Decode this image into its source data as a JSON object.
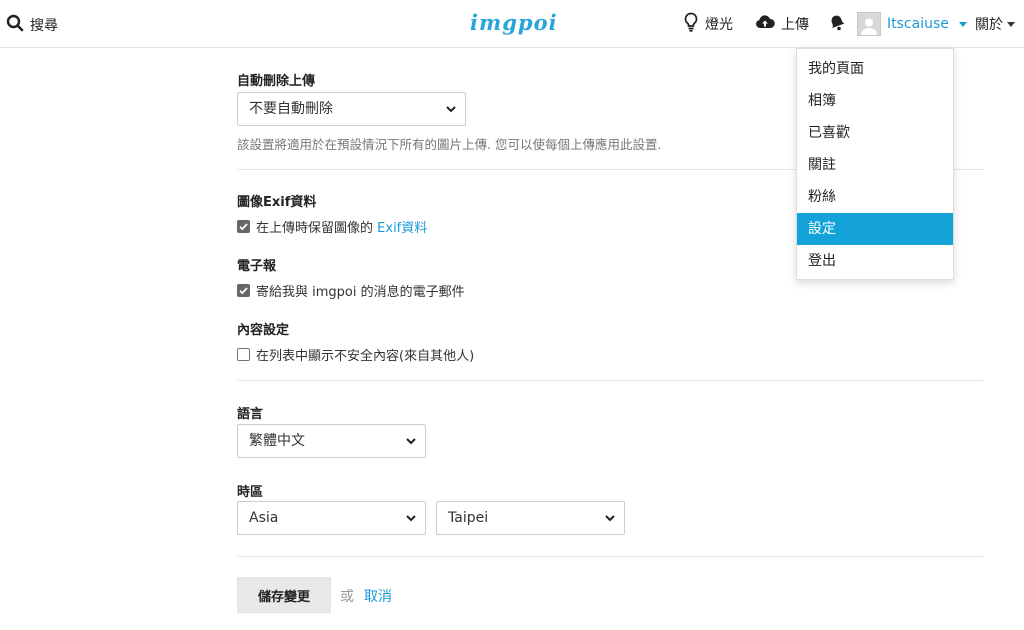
{
  "header": {
    "search_label": "搜尋",
    "logo": "imgpoi",
    "light_label": "燈光",
    "upload_label": "上傳",
    "username": "Itscaiuse",
    "about_label": "關於"
  },
  "user_menu": {
    "items": [
      "我的頁面",
      "相簿",
      "已喜歡",
      "關註",
      "粉絲",
      "設定",
      "登出"
    ],
    "active_index": 5
  },
  "settings": {
    "auto_delete": {
      "label": "自動刪除上傳",
      "value": "不要自動刪除",
      "help": "該設置將適用於在預設情況下所有的圖片上傳. 您可以使每個上傳應用此設置."
    },
    "exif": {
      "label": "圖像Exif資料",
      "checkbox_text": "在上傳時保留圖像的",
      "checkbox_link": "Exif資料",
      "checked": true
    },
    "newsletter": {
      "label": "電子報",
      "checkbox_text": "寄給我與 imgpoi 的消息的電子郵件",
      "checked": true
    },
    "content": {
      "label": "內容設定",
      "checkbox_text": "在列表中顯示不安全內容(來自其他人)",
      "checked": false
    },
    "language": {
      "label": "語言",
      "value": "繁體中文"
    },
    "timezone": {
      "label": "時區",
      "region": "Asia",
      "city": "Taipei"
    }
  },
  "actions": {
    "save_label": "儲存變更",
    "or_label": "或",
    "cancel_label": "取消"
  },
  "colors": {
    "accent": "#13a3d8",
    "link": "#1a9ad6"
  }
}
